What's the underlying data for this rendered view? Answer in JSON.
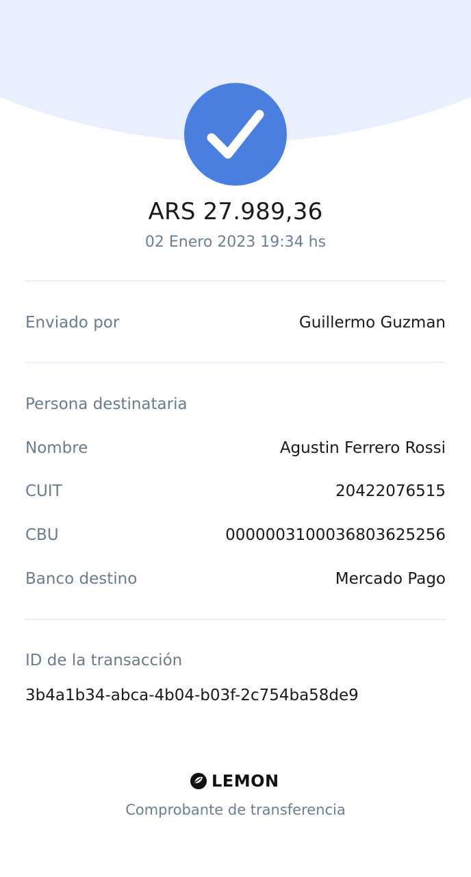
{
  "colors": {
    "accent": "#4a7fe0",
    "header_bg": "#e9effc",
    "divider": "#e7f1fb",
    "label_text": "#6a7b90",
    "value_text": "#1a1a1a"
  },
  "status": {
    "icon": "check-icon",
    "amount": "ARS 27.989,36",
    "date": "02 Enero 2023 19:34 hs"
  },
  "sender": {
    "label": "Enviado por",
    "value": "Guillermo Guzman"
  },
  "recipient": {
    "section_title": "Persona destinataria",
    "fields": [
      {
        "label": "Nombre",
        "value": "Agustin Ferrero Rossi"
      },
      {
        "label": "CUIT",
        "value": "20422076515"
      },
      {
        "label": "CBU",
        "value": "0000003100036803625256"
      },
      {
        "label": "Banco destino",
        "value": "Mercado Pago"
      }
    ]
  },
  "transaction": {
    "label": "ID de la transacción",
    "id": "3b4a1b34-abca-4b04-b03f-2c754ba58de9"
  },
  "footer": {
    "logo_icon": "lemon-logo-icon",
    "brand": "LEMON",
    "caption": "Comprobante de transferencia"
  }
}
